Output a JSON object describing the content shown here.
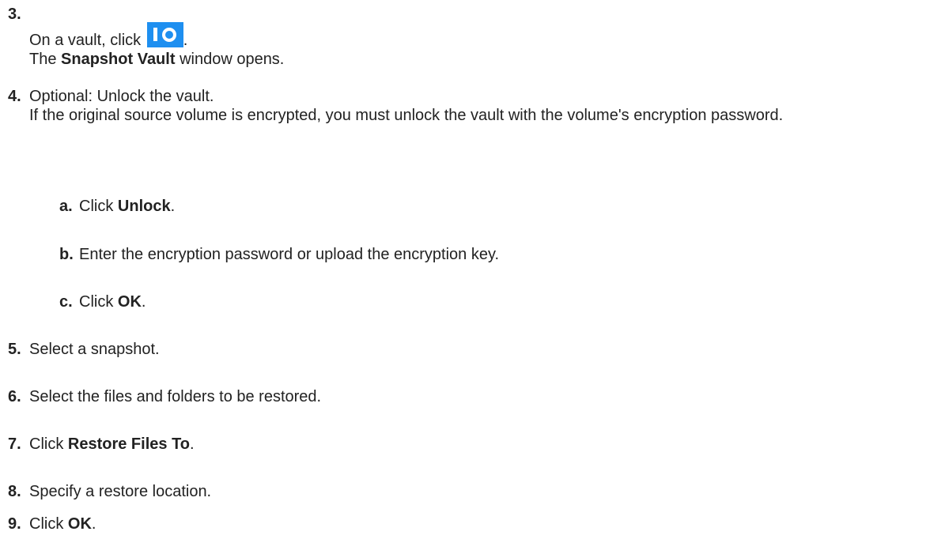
{
  "steps": [
    {
      "number": "3.",
      "line1_pre": "On a vault, click",
      "line1_post": ".",
      "icon": "vault-open-icon",
      "line2_pre": "The",
      "line2_bold": "Snapshot Vault",
      "line2_post": "window opens."
    },
    {
      "number": "4.",
      "line1": "Optional: Unlock the vault.",
      "line2": "If the original source volume is encrypted, you must unlock the vault with the volume's encryption password.",
      "substeps": [
        {
          "letter": "a.",
          "pre": "Click",
          "bold": "Unlock",
          "post": "."
        },
        {
          "letter": "b.",
          "text": "Enter the encryption password or upload the encryption key."
        },
        {
          "letter": "c.",
          "pre": "Click",
          "bold": "OK",
          "post": "."
        }
      ]
    },
    {
      "number": "5.",
      "text": "Select a snapshot."
    },
    {
      "number": "6.",
      "text": "Select the files and folders to be restored."
    },
    {
      "number": "7.",
      "pre": "Click",
      "bold": "Restore Files To",
      "post": "."
    },
    {
      "number": "8.",
      "text": "Specify a restore location."
    },
    {
      "number": "9.",
      "pre": "Click",
      "bold": "OK",
      "post": "."
    }
  ],
  "colors": {
    "icon_background": "#1e8ff0",
    "text": "#222222"
  }
}
